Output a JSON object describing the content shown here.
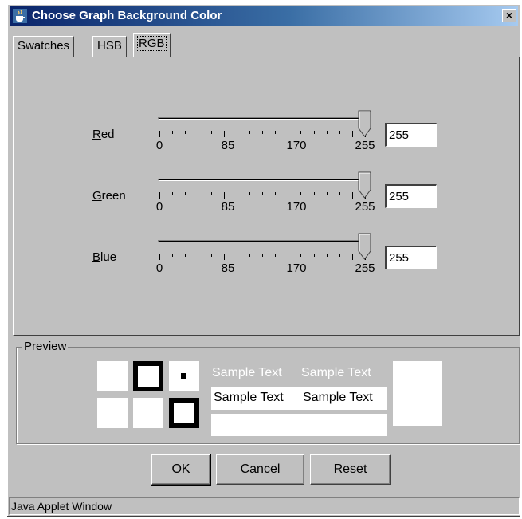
{
  "window": {
    "title": "Choose Graph Background Color",
    "close_label": "×"
  },
  "tabs": [
    {
      "label": "Swatches",
      "active": false
    },
    {
      "label": "HSB",
      "active": false
    },
    {
      "label": "RGB",
      "active": true
    }
  ],
  "sliders": [
    {
      "label": "Red",
      "mnemonic": "R",
      "rest": "ed",
      "value": "255",
      "fraction": 1.0
    },
    {
      "label": "Green",
      "mnemonic": "G",
      "rest": "reen",
      "value": "255",
      "fraction": 1.0
    },
    {
      "label": "Blue",
      "mnemonic": "B",
      "rest": "lue",
      "value": "255",
      "fraction": 1.0
    }
  ],
  "slider_scale": {
    "min": 0,
    "max": 255,
    "tick_labels": [
      "0",
      "85",
      "170",
      "255"
    ]
  },
  "preview": {
    "legend": "Preview",
    "sample_text": "Sample Text",
    "selected_color": "#ffffff"
  },
  "buttons": {
    "ok": "OK",
    "cancel": "Cancel",
    "reset": "Reset"
  },
  "status_bar": "Java Applet Window"
}
